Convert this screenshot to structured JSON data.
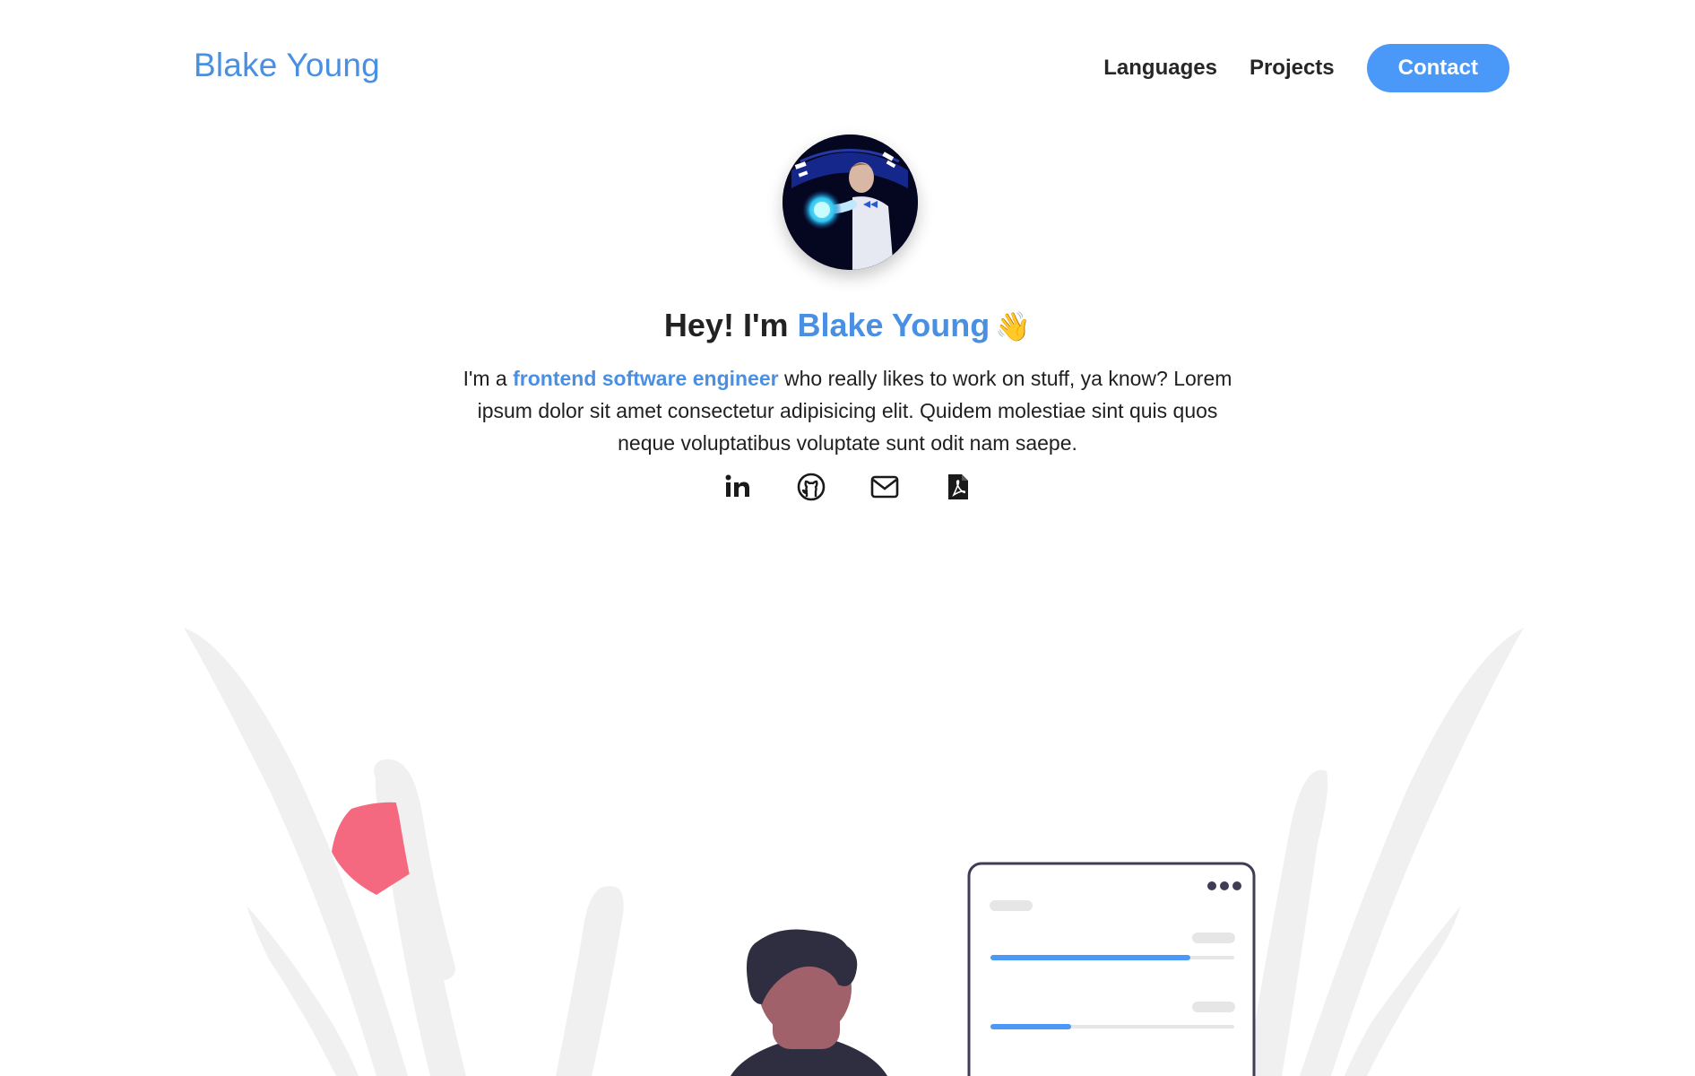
{
  "nav": {
    "brand": "Blake Young",
    "links": [
      "Languages",
      "Projects"
    ],
    "contact_label": "Contact"
  },
  "hero": {
    "greeting_prefix": "Hey! I'm ",
    "name": "Blake Young",
    "wave_emoji": "👋",
    "intro_prefix": "I'm a ",
    "role": "frontend software engineer",
    "intro_suffix": " who really likes to work on stuff, ya know? Lorem ipsum dolor sit amet consectetur adipisicing elit. Quidem molestiae sint quis quos neque voluptatibus voluptate sunt odit nam saepe."
  },
  "socials": [
    {
      "icon": "linkedin-icon"
    },
    {
      "icon": "github-icon"
    },
    {
      "icon": "mail-icon"
    },
    {
      "icon": "pdf-resume-icon"
    }
  ],
  "colors": {
    "accent": "#4a90e2",
    "button": "#4a98f7",
    "illustration_pink": "#f4697f",
    "illustration_dark": "#2f2e41",
    "leaf_gray": "#f0f0f0"
  },
  "illustration": {
    "progress": [
      0.82,
      0.33
    ]
  }
}
